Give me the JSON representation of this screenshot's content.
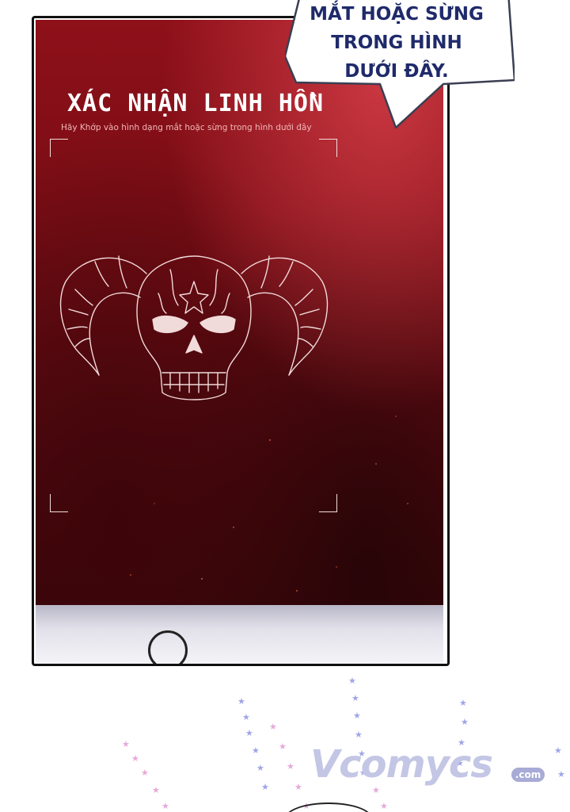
{
  "bubble": {
    "line1": "MẮT HOẶC SỪNG",
    "line2": "TRONG HÌNH",
    "line3": "DƯỚI ĐÂY."
  },
  "screen": {
    "title": "XÁC NHẬN LINH HỒN",
    "subtitle": "Hãy Khớp vào hình dạng mắt hoặc sừng trong hình dưới đây",
    "image_icon": "horned-skull-icon"
  },
  "watermark": {
    "text": "Vcomycs",
    "suffix": ".com"
  },
  "colors": {
    "screen_red": "#8e1019",
    "bubble_text": "#1f2a6b",
    "watermark": "#c3c6e4"
  }
}
